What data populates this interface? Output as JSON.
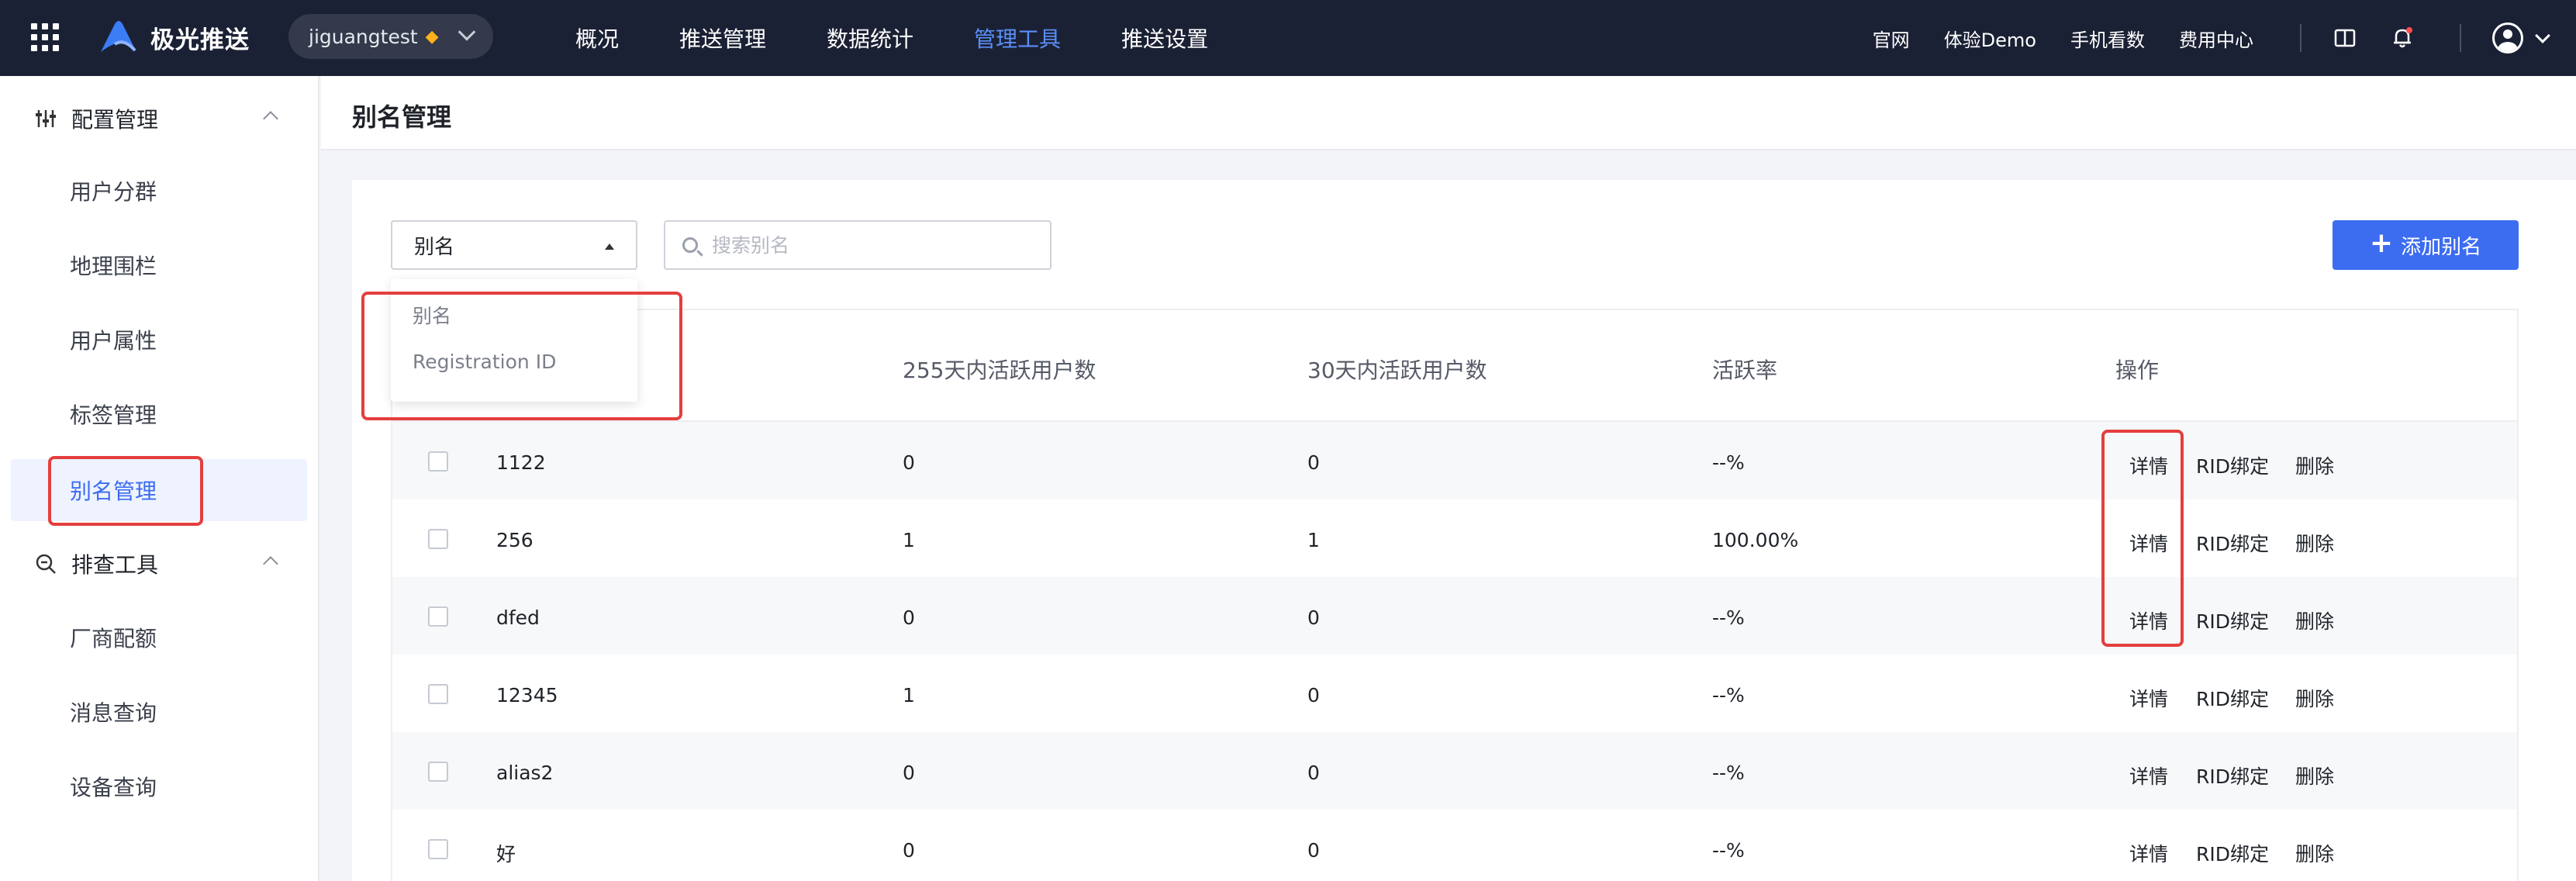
{
  "topnav": {
    "brand": "极光推送",
    "account": "jiguangtest",
    "items": [
      {
        "label": "概况"
      },
      {
        "label": "推送管理"
      },
      {
        "label": "数据统计"
      },
      {
        "label": "管理工具"
      },
      {
        "label": "推送设置"
      }
    ],
    "right_links": [
      {
        "label": "官网"
      },
      {
        "label": "体验Demo"
      },
      {
        "label": "手机看数"
      },
      {
        "label": "费用中心"
      }
    ],
    "active_color": "#5b8ff9"
  },
  "sidebar": {
    "groups": [
      {
        "label": "配置管理",
        "icon": "sliders-icon"
      },
      {
        "label": "排查工具",
        "icon": "zoom-search-icon"
      }
    ],
    "items": [
      {
        "label": "用户分群"
      },
      {
        "label": "地理围栏"
      },
      {
        "label": "用户属性"
      },
      {
        "label": "标签管理"
      },
      {
        "label": "别名管理"
      },
      {
        "label": "厂商配额"
      },
      {
        "label": "消息查询"
      },
      {
        "label": "设备查询"
      }
    ]
  },
  "page": {
    "title": "别名管理",
    "select_value": "别名",
    "search_placeholder": "搜索别名",
    "add_button": "添加别名",
    "dropdown_options": [
      "别名",
      "Registration ID"
    ]
  },
  "table": {
    "columns": [
      "255天内活跃用户数",
      "30天内活跃用户数",
      "活跃率",
      "操作"
    ],
    "actions": [
      "详情",
      "RID绑定",
      "删除"
    ],
    "rows": [
      {
        "alias": "1122",
        "active255": "0",
        "active30": "0",
        "rate": "--%"
      },
      {
        "alias": "256",
        "active255": "1",
        "active30": "1",
        "rate": "100.00%"
      },
      {
        "alias": "dfed",
        "active255": "0",
        "active30": "0",
        "rate": "--%"
      },
      {
        "alias": "12345",
        "active255": "1",
        "active30": "0",
        "rate": "--%"
      },
      {
        "alias": "alias2",
        "active255": "0",
        "active30": "0",
        "rate": "--%"
      },
      {
        "alias": "好",
        "active255": "0",
        "active30": "0",
        "rate": "--%"
      }
    ]
  },
  "colors": {
    "primary": "#3c6cf0",
    "nav_bg": "#1b2134",
    "annotation": "#e53e3e"
  }
}
